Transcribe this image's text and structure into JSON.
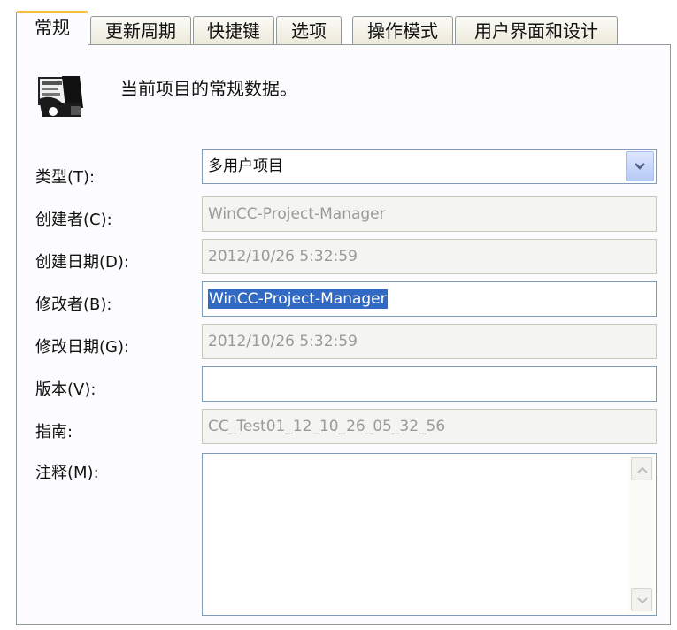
{
  "tabs": [
    "常规",
    "更新周期",
    "快捷键",
    "选项",
    "操作模式",
    "用户界面和设计"
  ],
  "header": {
    "description": "当前项目的常规数据。"
  },
  "fields": {
    "type": {
      "label": "类型(T):",
      "value": "多用户项目"
    },
    "creator": {
      "label": "创建者(C):",
      "value": "WinCC-Project-Manager"
    },
    "created_date": {
      "label": "创建日期(D):",
      "value": "2012/10/26 5:32:59"
    },
    "modifier": {
      "label": "修改者(B):",
      "value": "WinCC-Project-Manager"
    },
    "modified_date": {
      "label": "修改日期(G):",
      "value": "2012/10/26 5:32:59"
    },
    "version": {
      "label": "版本(V):",
      "value": ""
    },
    "guide": {
      "label": "指南:",
      "value": "CC_Test01_12_10_26_05_32_56"
    },
    "notes": {
      "label": "注释(M):",
      "value": ""
    }
  },
  "icons": {
    "project": "project-properties-icon",
    "dropdown": "chevron-down-icon",
    "scroll_up": "scroll-up-icon",
    "scroll_down": "scroll-down-icon"
  },
  "colors": {
    "active_tab_accent": "#f5b93a",
    "selection": "#316ac5"
  }
}
